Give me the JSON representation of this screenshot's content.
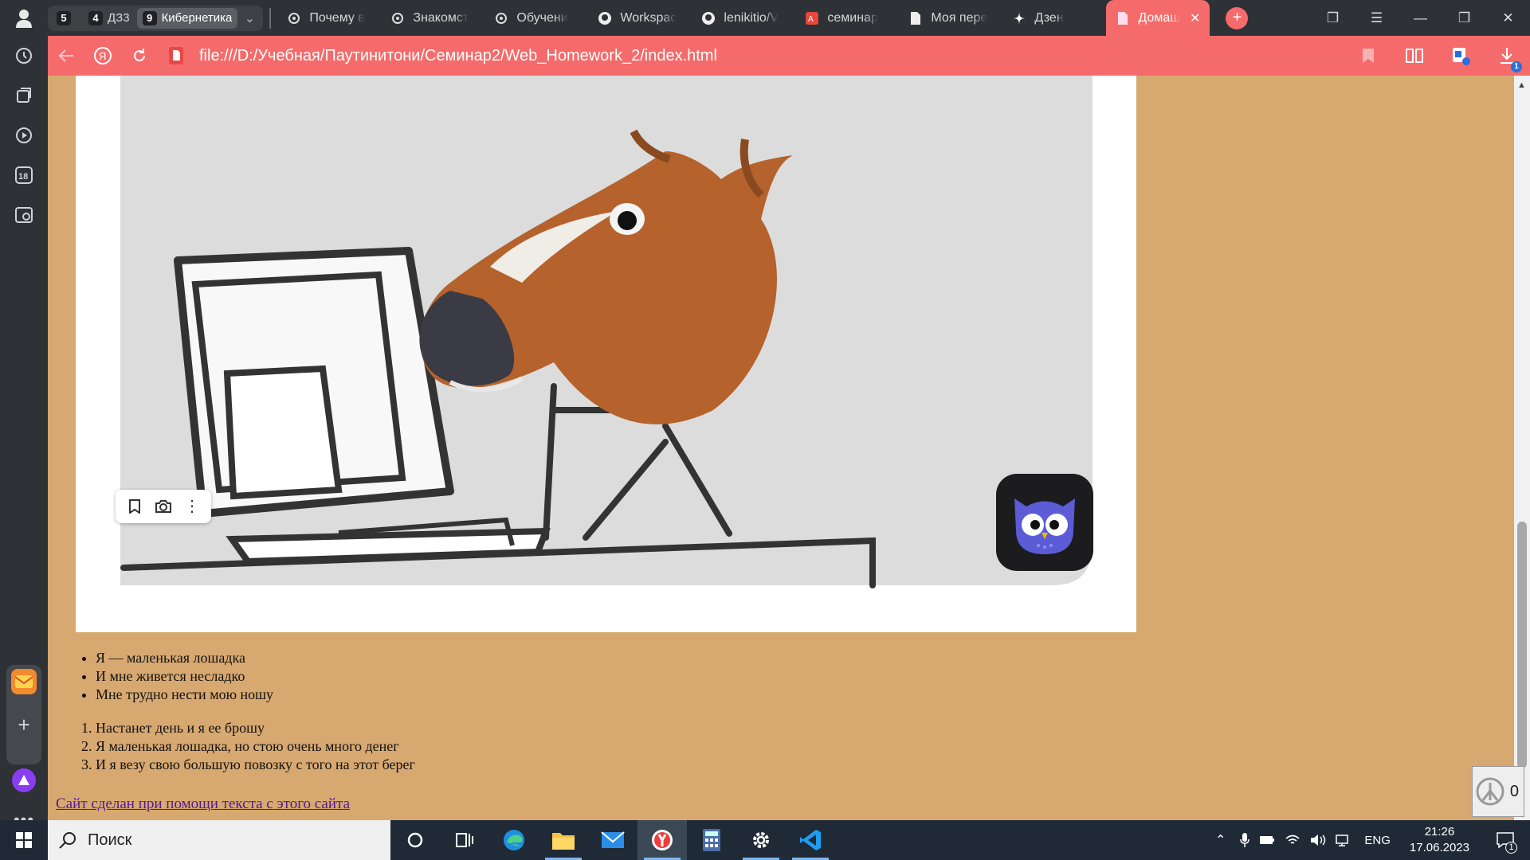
{
  "browser": {
    "tab_groups": [
      {
        "count": "5",
        "label": ""
      },
      {
        "count": "4",
        "label": "ДЗ3"
      },
      {
        "count": "9",
        "label": "Кибернетика"
      }
    ],
    "tabs": [
      {
        "label": "Почему в",
        "icon": "openai-icon"
      },
      {
        "label": "Знакомст",
        "icon": "openai-icon"
      },
      {
        "label": "Обучени",
        "icon": "openai-icon"
      },
      {
        "label": "Workspac",
        "icon": "github-icon"
      },
      {
        "label": "lenikitio/V",
        "icon": "github-icon"
      },
      {
        "label": "семинар",
        "icon": "translate-icon"
      },
      {
        "label": "Моя пере",
        "icon": "document-icon"
      },
      {
        "label": "Дзен",
        "icon": "zen-icon"
      },
      {
        "label": "Домаш",
        "icon": "document-icon",
        "active": true
      }
    ],
    "address_url": "file:///D:/Учебная/Паутинитони/Семинар2/Web_Homework_2/index.html",
    "download_badge": "1",
    "accent": "#f56b6b"
  },
  "page": {
    "bullet_items": [
      "Я — маленькая лошадка",
      "И мне живется несладко",
      "Мне трудно нести мою ношу"
    ],
    "ordered_items": [
      "Настанет день и я ее брошу",
      "Я маленькая лошадка, но стою очень много денег",
      "И я везу свою большую повозку с того на этот берег"
    ],
    "credit_link": "Сайт сделан при помощи текста с этого сайта",
    "counter_widget": "0",
    "background": "#d7a870"
  },
  "taskbar": {
    "search_placeholder": "Поиск",
    "language": "ENG",
    "time": "21:26",
    "date": "17.06.2023",
    "notification_count": "1"
  }
}
